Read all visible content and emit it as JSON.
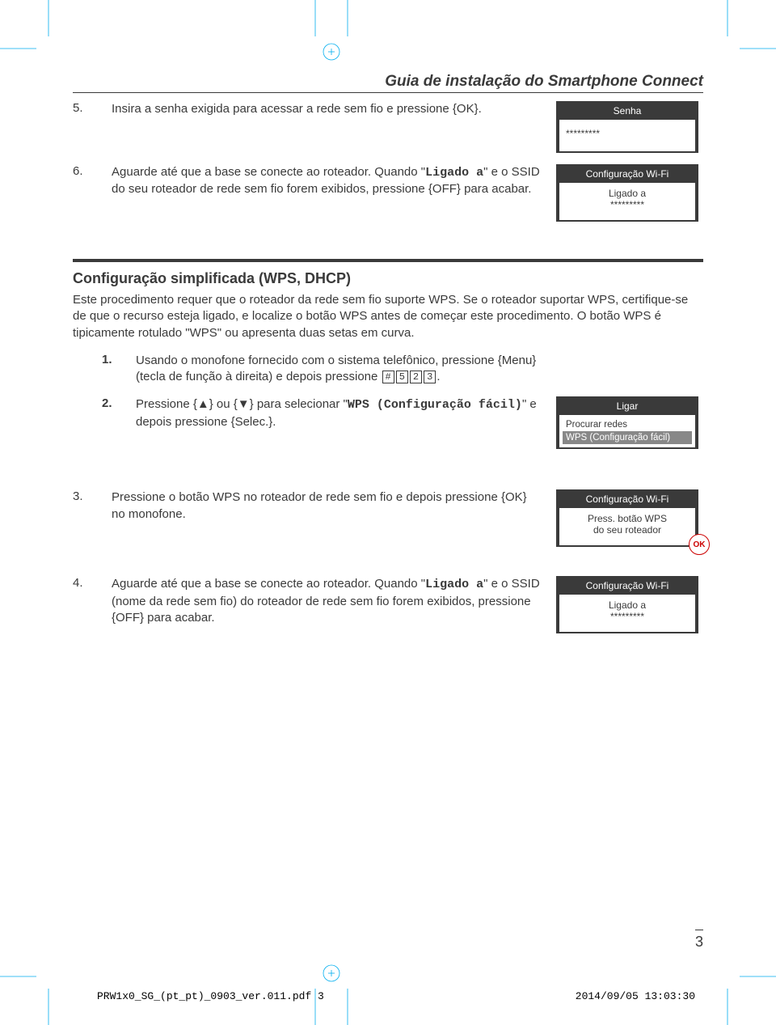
{
  "header": {
    "title": "Guia de instalação do Smartphone Connect"
  },
  "step5": {
    "num": "5.",
    "text_a": "Insira a senha exigida para acessar a rede sem fio e pressione ",
    "key": "{OK}",
    "text_b": ".",
    "screen": {
      "title": "Senha",
      "line1": "*********"
    }
  },
  "step6": {
    "num": "6.",
    "text_a": "Aguarde até que a base se conecte ao roteador. Quando \"",
    "mono": "Ligado a",
    "text_b": "\" e o SSID do seu roteador de rede sem fio forem exibidos, pressione ",
    "key": "{OFF}",
    "text_c": " para acabar.",
    "screen": {
      "title": "Configuração Wi-Fi",
      "line1": "Ligado a",
      "line2": "*********"
    }
  },
  "section2": {
    "title": "Configuração simplificada (WPS, DHCP)",
    "intro": "Este procedimento requer que o roteador da rede sem fio suporte WPS. Se o roteador suportar WPS, certifique-se de que o recurso esteja ligado, e localize o botão WPS antes de começar este procedimento. O botão WPS é tipicamente rotulado \"WPS\" ou apresenta duas setas em curva."
  },
  "s2_step1": {
    "num": "1.",
    "text_a": "Usando o monofone fornecido com o sistema telefônico, pressione ",
    "key": "{Menu}",
    "text_b": " (tecla de função à direita) e depois pressione ",
    "kc1": "#",
    "kc2": "5",
    "kc3": "2",
    "kc4": "3",
    "text_c": "."
  },
  "s2_step2": {
    "num": "2.",
    "text_a": "Pressione ",
    "key_up": "{▲}",
    "text_or": " ou ",
    "key_dn": "{▼}",
    "text_b": " para selecionar \"",
    "mono": "WPS (Configuração fácil)",
    "text_c": "\" e depois pressione ",
    "key_sel": "{Selec.}",
    "text_d": ".",
    "screen": {
      "title": "Ligar",
      "item1": "Procurar redes",
      "item2": "WPS (Configuração fácil)"
    }
  },
  "s2_step3": {
    "num": "3.",
    "text_a": "Pressione o botão WPS no roteador de rede sem fio e depois pressione ",
    "key": "{OK}",
    "text_b": " no monofone.",
    "screen": {
      "title": "Configuração Wi-Fi",
      "line1": "Press. botão WPS",
      "line2": "do seu roteador",
      "stamp": "OK"
    }
  },
  "s2_step4": {
    "num": "4.",
    "text_a": "Aguarde até que a base se conecte ao roteador. Quando \"",
    "mono": "Ligado a",
    "text_b": "\" e o SSID (nome da rede sem fio) do roteador de rede sem fio forem exibidos, pressione ",
    "key": "{OFF}",
    "text_c": " para acabar.",
    "screen": {
      "title": "Configuração Wi-Fi",
      "line1": "Ligado a",
      "line2": "*********"
    }
  },
  "page_number": "3",
  "footer": {
    "left": "PRW1x0_SG_(pt_pt)_0903_ver.011.pdf   3",
    "right": "2014/09/05   13:03:30"
  }
}
